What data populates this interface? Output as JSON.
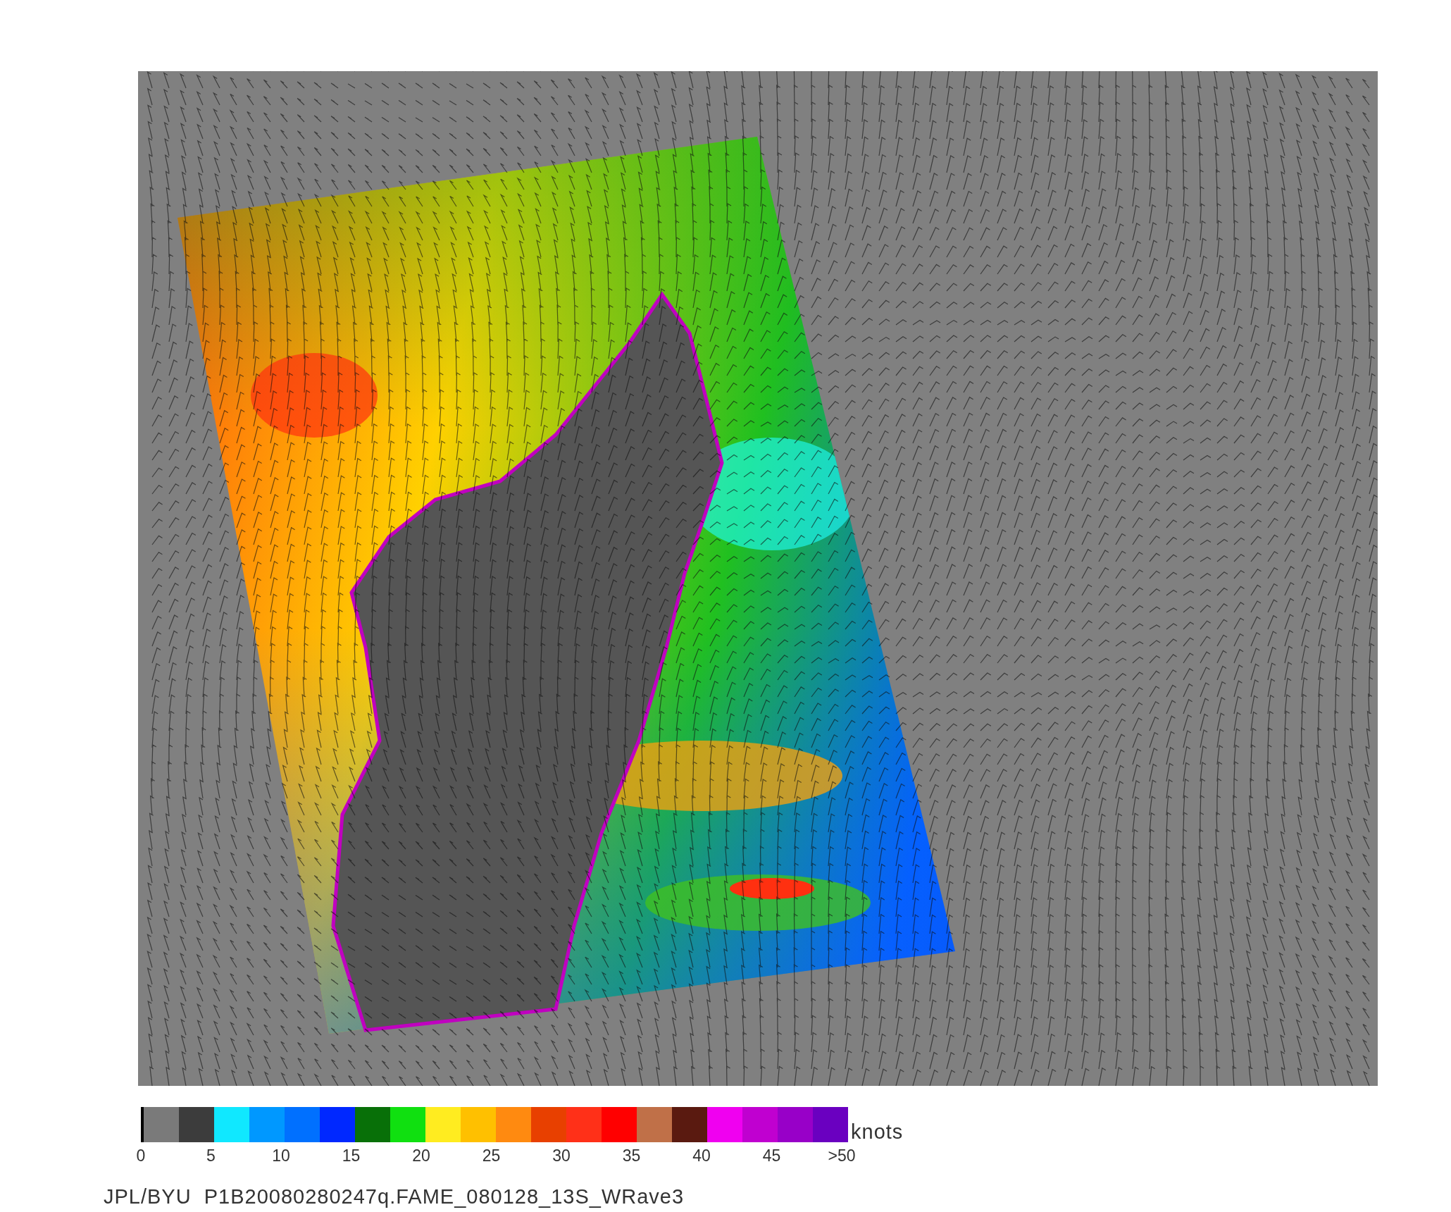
{
  "colorbar": {
    "segments": [
      {
        "color": "#7a7a7a"
      },
      {
        "color": "#3c3c3c"
      },
      {
        "color": "#10e8ff"
      },
      {
        "color": "#0098ff"
      },
      {
        "color": "#0070ff"
      },
      {
        "color": "#0028ff"
      },
      {
        "color": "#087008"
      },
      {
        "color": "#10e010"
      },
      {
        "color": "#ffec20"
      },
      {
        "color": "#ffc000"
      },
      {
        "color": "#ff8a10"
      },
      {
        "color": "#e84000"
      },
      {
        "color": "#ff3018"
      },
      {
        "color": "#ff0000"
      },
      {
        "color": "#c07048"
      },
      {
        "color": "#5a1a10"
      },
      {
        "color": "#f000f0"
      },
      {
        "color": "#c000d0"
      },
      {
        "color": "#9800c8"
      },
      {
        "color": "#6a00c0"
      }
    ],
    "ticks": [
      "0",
      "5",
      "10",
      "15",
      "20",
      "25",
      "30",
      "35",
      "40",
      "45",
      ">50"
    ],
    "unit": "knots"
  },
  "caption": "JPL/BYU  P1B20080280247q.FAME_080128_13S_WRave3"
}
